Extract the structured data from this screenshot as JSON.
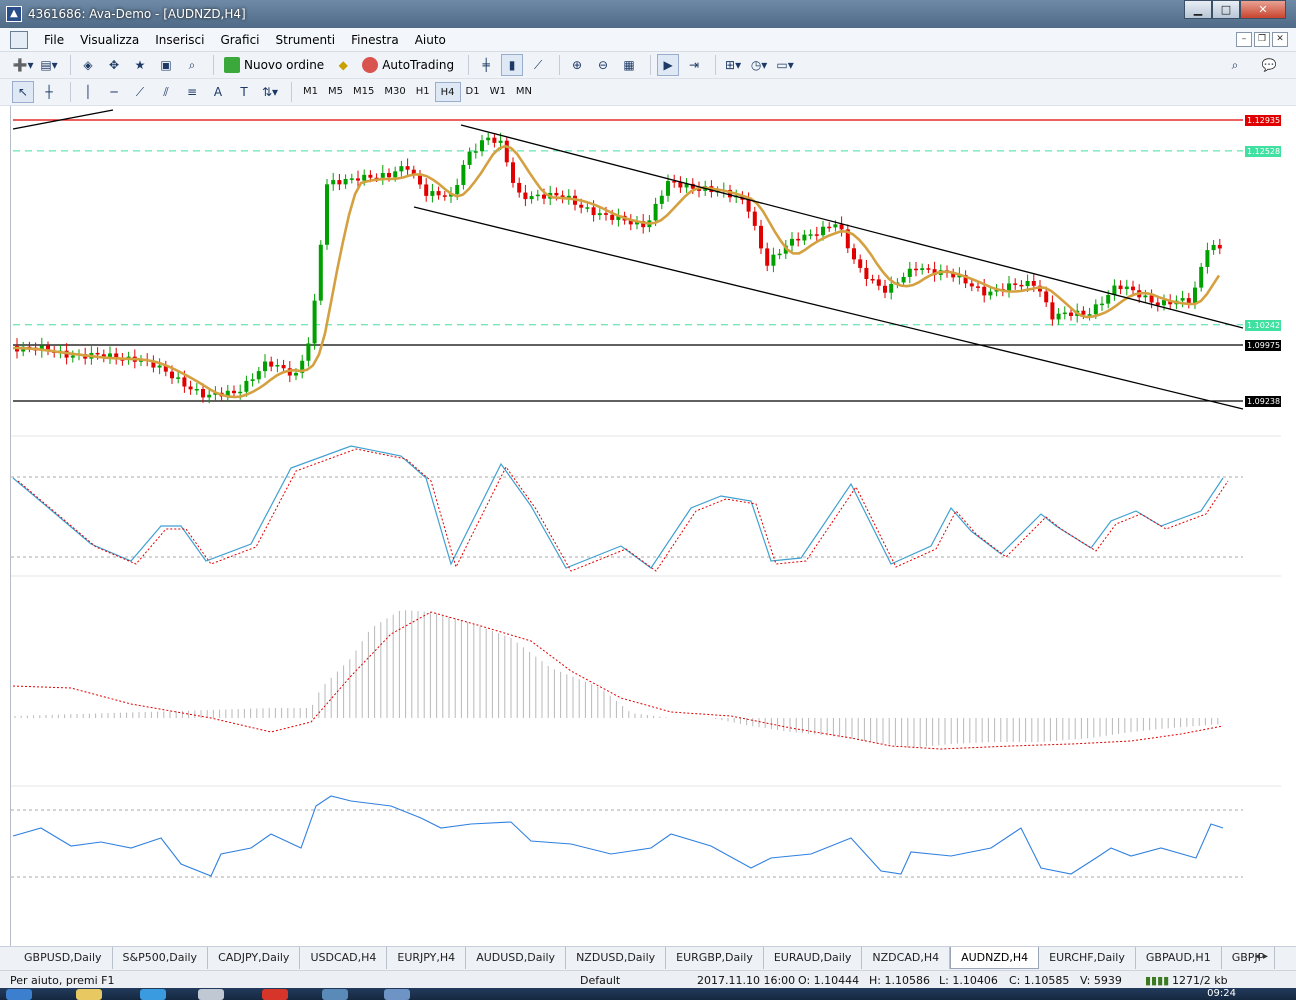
{
  "window": {
    "title": "4361686: Ava-Demo - [AUDNZD,H4]"
  },
  "menu": {
    "items": [
      "File",
      "Visualizza",
      "Inserisci",
      "Grafici",
      "Strumenti",
      "Finestra",
      "Aiuto"
    ]
  },
  "toolbar": {
    "new_order_label": "Nuovo ordine",
    "autotrading_label": "AutoTrading"
  },
  "timeframes": {
    "items": [
      "M1",
      "M5",
      "M15",
      "M30",
      "H1",
      "H4",
      "D1",
      "W1",
      "MN"
    ],
    "active": "H4"
  },
  "chart": {
    "symbol": "AUDNZD,H4",
    "price_levels": [
      {
        "label": "1.12935",
        "value": 1.12935,
        "color": "#e00000",
        "style": "solid"
      },
      {
        "label": "1.12528",
        "value": 1.12528,
        "color": "#40e0a0",
        "style": "dashed"
      },
      {
        "label": "1.10242",
        "value": 1.10242,
        "color": "#40e0a0",
        "style": "dashed"
      },
      {
        "label": "1.09975",
        "value": 1.09975,
        "color": "#000000",
        "style": "solid"
      },
      {
        "label": "1.09238",
        "value": 1.09238,
        "color": "#000000",
        "style": "solid"
      }
    ],
    "colors": {
      "bull": "#00a000",
      "bear": "#e00000",
      "ma": "#d4a040",
      "stoch_main": "#40a0d0",
      "stoch_signal": "#e00000",
      "rsi": "#3080e0"
    }
  },
  "tabs": {
    "items": [
      "GBPUSD,Daily",
      "S&P500,Daily",
      "CADJPY,Daily",
      "USDCAD,H4",
      "EURJPY,H4",
      "AUDUSD,Daily",
      "NZDUSD,Daily",
      "EURGBP,Daily",
      "EURAUD,Daily",
      "NZDCAD,H4",
      "AUDNZD,H4",
      "EURCHF,Daily",
      "GBPAUD,H1",
      "GBPJP"
    ],
    "active": "AUDNZD,H4"
  },
  "status": {
    "help": "Per aiuto, premi F1",
    "profile": "Default",
    "datetime": "2017.11.10 16:00",
    "open": "O: 1.10444",
    "high": "H: 1.10586",
    "low": "L: 1.10406",
    "close": "C: 1.10585",
    "volume": "V: 5939",
    "traffic": "1271/2 kb"
  },
  "taskbar": {
    "clock": "09:24"
  }
}
